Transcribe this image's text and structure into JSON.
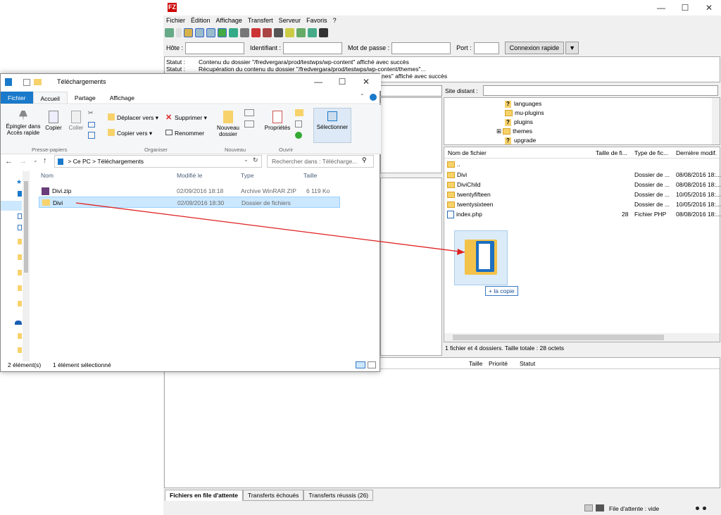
{
  "filezilla": {
    "logo": "FZ",
    "win_controls": {
      "min": "—",
      "max": "☐",
      "close": "✕"
    },
    "menu": [
      "Fichier",
      "Édition",
      "Affichage",
      "Transfert",
      "Serveur",
      "Favoris",
      "?"
    ],
    "quickconnect": {
      "host_label": "Hôte :",
      "user_label": "Identifiant :",
      "pass_label": "Mot de passe :",
      "port_label": "Port :",
      "button": "Connexion rapide",
      "dropdown": "▼"
    },
    "log": [
      {
        "k": "Statut :",
        "v": "Contenu du dossier \"/fredvergara/prod/testwps/wp-content\" affiché avec succès"
      },
      {
        "k": "Statut :",
        "v": "Récupération du contenu du dossier \"/fredvergara/prod/testwps/wp-content/themes\"..."
      },
      {
        "k": "",
        "v": "nes\" affiché avec succès"
      }
    ],
    "remote_site_label": "Site distant :",
    "remote_tree": [
      {
        "name": "languages",
        "icon": "?"
      },
      {
        "name": "mu-plugins",
        "icon": ""
      },
      {
        "name": "plugins",
        "icon": "?"
      },
      {
        "name": "themes",
        "icon": "",
        "expand": "⊞"
      },
      {
        "name": "upgrade",
        "icon": "?"
      }
    ],
    "remote_columns": [
      "Nom de fichier",
      "Taille de fi...",
      "Type de fic...",
      "Dernière modif."
    ],
    "remote_files": [
      {
        "name": "..",
        "size": "",
        "type": "",
        "date": ""
      },
      {
        "name": "Divi",
        "size": "",
        "type": "Dossier de ...",
        "date": "08/08/2016 18:..."
      },
      {
        "name": "DiviChild",
        "size": "",
        "type": "Dossier de ...",
        "date": "08/08/2016 18:..."
      },
      {
        "name": "twentyfifteen",
        "size": "",
        "type": "Dossier de ...",
        "date": "10/05/2016 18:..."
      },
      {
        "name": "twentysixteen",
        "size": "",
        "type": "Dossier de ...",
        "date": "10/05/2016 18:..."
      },
      {
        "name": "index.php",
        "size": "28",
        "type": "Fichier PHP",
        "date": "08/08/2016 18:..."
      }
    ],
    "remote_status": "1 fichier et 4 dossiers. Taille totale : 28 octets",
    "queue_columns": [
      "Taille",
      "Priorité",
      "Statut"
    ],
    "tabs": [
      "Fichiers en file d'attente",
      "Transferts échoués",
      "Transferts réussis (26)"
    ],
    "statusbar": "File d'attente : vide",
    "drag_label": "+ la copie"
  },
  "explorer": {
    "title": "Téléchargements",
    "win_controls": {
      "min": "—",
      "max": "☐",
      "close": "✕"
    },
    "ribbon_tabs": [
      "Fichier",
      "Accueil",
      "Partage",
      "Affichage"
    ],
    "ribbon": {
      "pin": "Épingler dans Accès rapide",
      "copy": "Copier",
      "paste": "Coller",
      "move": "Déplacer vers ▾",
      "copyto": "Copier vers ▾",
      "delete": "Supprimer ▾",
      "rename": "Renommer",
      "newfolder": "Nouveau dossier",
      "properties": "Propriétés",
      "select": "Sélectionner",
      "groups": [
        "Presse-papiers",
        "Organiser",
        "Nouveau",
        "Ouvrir"
      ]
    },
    "address": {
      "root": "Ce PC",
      "sep": ">",
      "folder": "Téléchargements"
    },
    "search_placeholder": "Rechercher dans : Télécharge...",
    "columns": [
      "Nom",
      "Modifié le",
      "Type",
      "Taille"
    ],
    "files": [
      {
        "name": "Divi.zip",
        "date": "02/09/2016 18:18",
        "type": "Archive WinRAR ZIP",
        "size": "6 119 Ko"
      },
      {
        "name": "Divi",
        "date": "02/09/2016 18:30",
        "type": "Dossier de fichiers",
        "size": ""
      }
    ],
    "status_count": "2 élément(s)",
    "status_selected": "1 élément sélectionné"
  },
  "colors": {
    "accent": "#1979ca",
    "selection": "#cce8ff",
    "arrow": "#e02020",
    "folder": "#f7d26b"
  }
}
